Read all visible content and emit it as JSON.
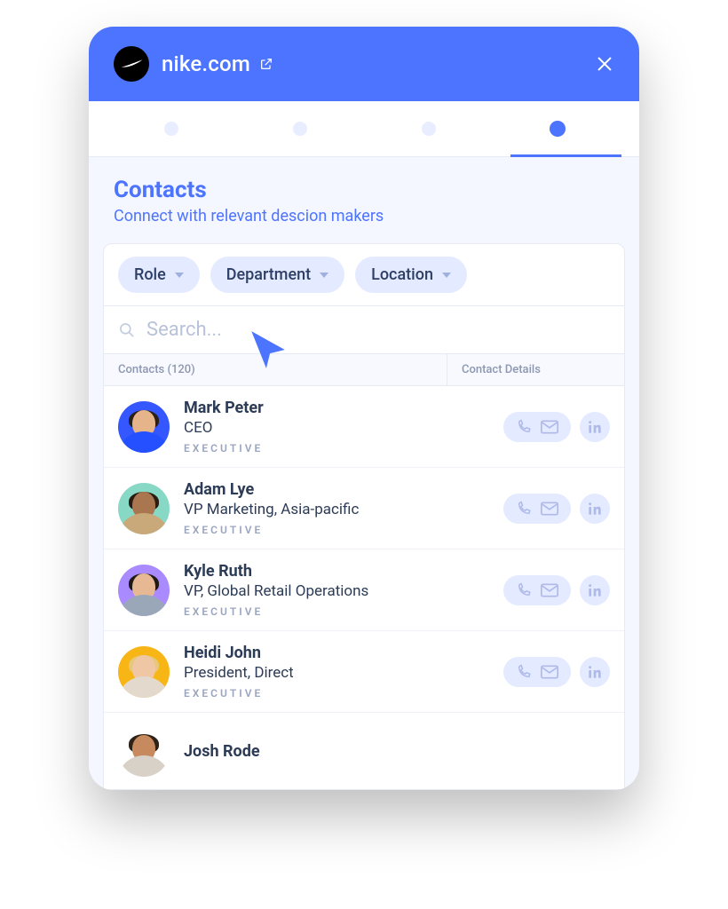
{
  "header": {
    "domain": "nike.com"
  },
  "section": {
    "title": "Contacts",
    "subtitle": "Connect with relevant descion makers"
  },
  "filters": [
    {
      "label": "Role"
    },
    {
      "label": "Department"
    },
    {
      "label": "Location"
    }
  ],
  "search": {
    "placeholder": "Search..."
  },
  "columns": {
    "contacts": "Contacts (120)",
    "details": "Contact Details"
  },
  "contacts": [
    {
      "name": "Mark Peter",
      "title": "CEO",
      "tag": "EXECUTIVE",
      "avatar": {
        "bg": "#3557ff",
        "hair": "#2a2016",
        "skin": "#e6b48b",
        "body": "#2450ff"
      }
    },
    {
      "name": "Adam Lye",
      "title": "VP Marketing, Asia-pacific",
      "tag": "EXECUTIVE",
      "avatar": {
        "bg": "#87d9c6",
        "hair": "#2b1c12",
        "skin": "#a9764f",
        "body": "#c9a97a"
      }
    },
    {
      "name": "Kyle Ruth",
      "title": "VP, Global Retail Operations",
      "tag": "EXECUTIVE",
      "avatar": {
        "bg": "#a98bff",
        "hair": "#1f1a14",
        "skin": "#e6b894",
        "body": "#9aa7b8"
      }
    },
    {
      "name": "Heidi John",
      "title": "President, Direct",
      "tag": "EXECUTIVE",
      "avatar": {
        "bg": "#f7b516",
        "hair": "#e7c77a",
        "skin": "#f0c7a4",
        "body": "#e3d9cc"
      }
    },
    {
      "name": "Josh Rode",
      "title": "",
      "tag": "",
      "avatar": {
        "bg": "#ffffff",
        "hair": "#2e2218",
        "skin": "#c78a5e",
        "body": "#d8d1c7"
      }
    }
  ]
}
